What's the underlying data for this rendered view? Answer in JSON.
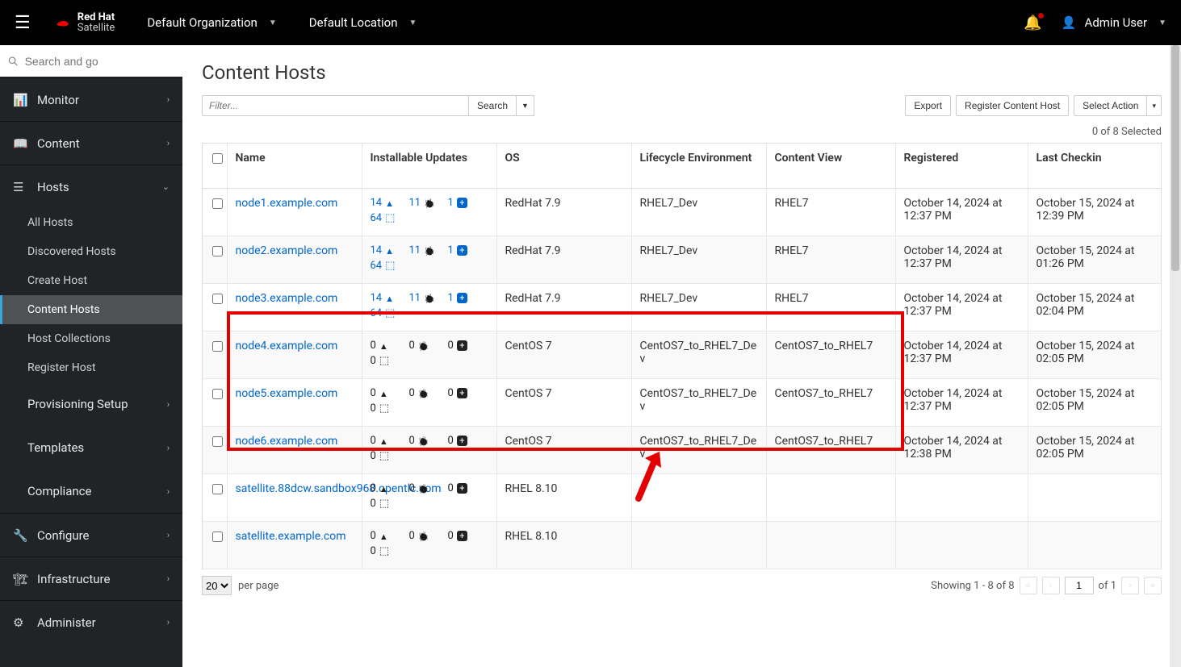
{
  "topbar": {
    "brand_line1": "Red Hat",
    "brand_line2": "Satellite",
    "org_label": "Default Organization",
    "loc_label": "Default Location",
    "user_label": "Admin User"
  },
  "sidebar": {
    "search_placeholder": "Search and go",
    "items": [
      {
        "icon": "dashboard",
        "label": "Monitor",
        "arrow": "right"
      },
      {
        "icon": "book",
        "label": "Content",
        "arrow": "right"
      },
      {
        "icon": "server",
        "label": "Hosts",
        "arrow": "down",
        "children": [
          {
            "label": "All Hosts"
          },
          {
            "label": "Discovered Hosts"
          },
          {
            "label": "Create Host"
          },
          {
            "label": "Content Hosts",
            "active": true
          },
          {
            "label": "Host Collections"
          },
          {
            "label": "Register Host"
          }
        ]
      },
      {
        "icon": "none",
        "label": "Provisioning Setup",
        "arrow": "right",
        "sub": true
      },
      {
        "icon": "none",
        "label": "Templates",
        "arrow": "right",
        "sub": true
      },
      {
        "icon": "none",
        "label": "Compliance",
        "arrow": "right",
        "sub": true
      },
      {
        "icon": "wrench",
        "label": "Configure",
        "arrow": "right"
      },
      {
        "icon": "infra",
        "label": "Infrastructure",
        "arrow": "right"
      },
      {
        "icon": "cog",
        "label": "Administer",
        "arrow": "right"
      }
    ]
  },
  "page": {
    "title": "Content Hosts",
    "filter_placeholder": "Filter...",
    "search_btn": "Search",
    "export_btn": "Export",
    "register_btn": "Register Content Host",
    "select_action_btn": "Select Action",
    "selected_text": "0 of 8 Selected"
  },
  "table": {
    "headers": {
      "name": "Name",
      "upd": "Installable Updates",
      "os": "OS",
      "env": "Lifecycle Environment",
      "cv": "Content View",
      "reg": "Registered",
      "chk": "Last Checkin"
    },
    "rows": [
      {
        "name": "node1.example.com",
        "upd": {
          "sec": 14,
          "bug": 11,
          "enh": 1,
          "pkg": 64,
          "blue": true
        },
        "os": "RedHat 7.9",
        "env": "RHEL7_Dev",
        "cv": "RHEL7",
        "reg": "October 14, 2024 at 12:37 PM",
        "chk": "October 15, 2024 at 12:39 PM"
      },
      {
        "name": "node2.example.com",
        "upd": {
          "sec": 14,
          "bug": 11,
          "enh": 1,
          "pkg": 64,
          "blue": true
        },
        "os": "RedHat 7.9",
        "env": "RHEL7_Dev",
        "cv": "RHEL7",
        "reg": "October 14, 2024 at 12:37 PM",
        "chk": "October 15, 2024 at 01:26 PM"
      },
      {
        "name": "node3.example.com",
        "upd": {
          "sec": 14,
          "bug": 11,
          "enh": 1,
          "pkg": 64,
          "blue": true
        },
        "os": "RedHat 7.9",
        "env": "RHEL7_Dev",
        "cv": "RHEL7",
        "reg": "October 14, 2024 at 12:37 PM",
        "chk": "October 15, 2024 at 02:04 PM"
      },
      {
        "name": "node4.example.com",
        "upd": {
          "sec": 0,
          "bug": 0,
          "enh": 0,
          "pkg": 0,
          "blue": false
        },
        "os": "CentOS 7",
        "env": "CentOS7_to_RHEL7_Dev",
        "cv": "CentOS7_to_RHEL7",
        "reg": "October 14, 2024 at 12:37 PM",
        "chk": "October 15, 2024 at 02:05 PM"
      },
      {
        "name": "node5.example.com",
        "upd": {
          "sec": 0,
          "bug": 0,
          "enh": 0,
          "pkg": 0,
          "blue": false
        },
        "os": "CentOS 7",
        "env": "CentOS7_to_RHEL7_Dev",
        "cv": "CentOS7_to_RHEL7",
        "reg": "October 14, 2024 at 12:37 PM",
        "chk": "October 15, 2024 at 02:05 PM"
      },
      {
        "name": "node6.example.com",
        "upd": {
          "sec": 0,
          "bug": 0,
          "enh": 0,
          "pkg": 0,
          "blue": false
        },
        "os": "CentOS 7",
        "env": "CentOS7_to_RHEL7_Dev",
        "cv": "CentOS7_to_RHEL7",
        "reg": "October 14, 2024 at 12:38 PM",
        "chk": "October 15, 2024 at 02:05 PM"
      },
      {
        "name": "satellite.88dcw.sandbox968.opentlc.com",
        "upd": {
          "sec": 0,
          "bug": 0,
          "enh": 0,
          "pkg": 0,
          "blue": false
        },
        "os": "RHEL 8.10",
        "env": "",
        "cv": "",
        "reg": "",
        "chk": ""
      },
      {
        "name": "satellite.example.com",
        "upd": {
          "sec": 0,
          "bug": 0,
          "enh": 0,
          "pkg": 0,
          "blue": false
        },
        "os": "RHEL 8.10",
        "env": "",
        "cv": "",
        "reg": "",
        "chk": ""
      }
    ]
  },
  "pager": {
    "per_page": "20",
    "per_page_label": "per page",
    "showing": "Showing 1 - 8 of 8",
    "page": "1",
    "of": "of 1"
  }
}
